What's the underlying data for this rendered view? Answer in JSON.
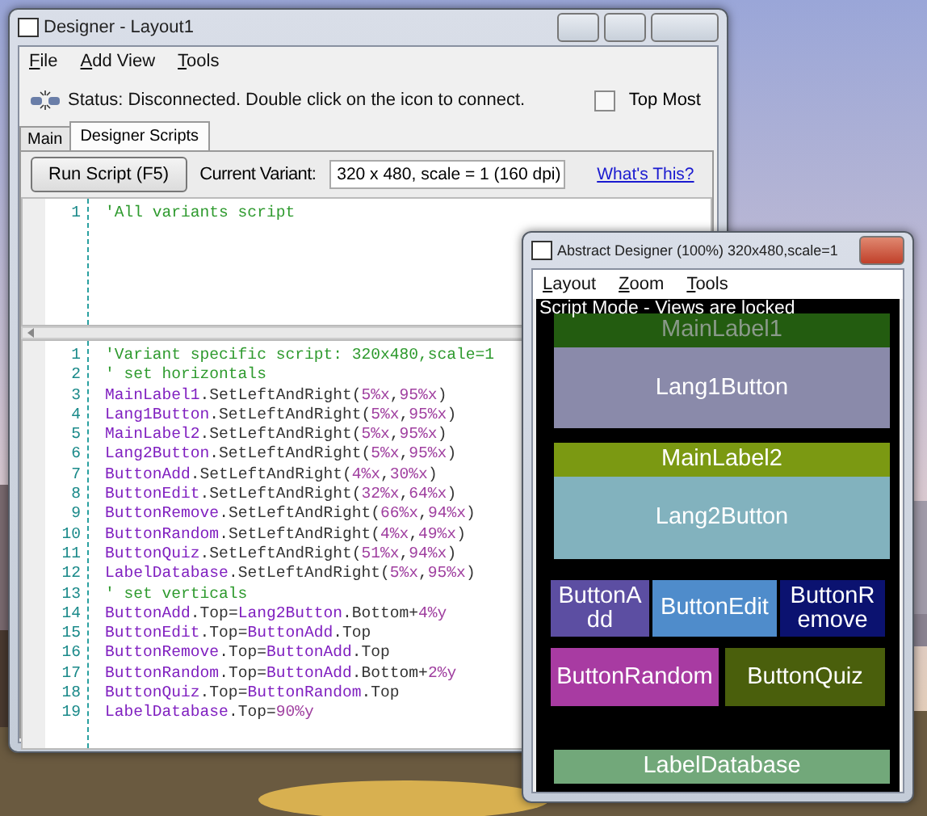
{
  "designer_window": {
    "title": "Designer - Layout1",
    "menu": [
      "File",
      "Add View",
      "Tools"
    ],
    "status": "Status: Disconnected. Double click on the icon to connect.",
    "top_most": {
      "label": "Top Most",
      "checked": false
    },
    "tabs": [
      {
        "label": "Main",
        "selected": false
      },
      {
        "label": "Designer Scripts",
        "selected": true
      }
    ],
    "run_button": "Run Script (F5)",
    "variant_label": "Current Variant:",
    "variant_value": "320 x 480, scale = 1 (160 dpi)",
    "help_link": "What's This?",
    "all_variants_script": [
      {
        "number": "1",
        "tokens": [
          {
            "kind": "comment",
            "text": "'All variants script"
          }
        ]
      }
    ],
    "variant_script": [
      {
        "number": "1",
        "tokens": [
          {
            "kind": "comment",
            "text": "'Variant specific script: 320x480,scale=1"
          }
        ]
      },
      {
        "number": "2",
        "tokens": [
          {
            "kind": "comment",
            "text": "' set horizontals"
          }
        ]
      },
      {
        "number": "3",
        "tokens": [
          {
            "kind": "ident",
            "text": "MainLabel1"
          },
          {
            "kind": "plain",
            "text": ".SetLeftAndRight("
          },
          {
            "kind": "number",
            "text": "5%x"
          },
          {
            "kind": "plain",
            "text": ","
          },
          {
            "kind": "number",
            "text": "95%x"
          },
          {
            "kind": "plain",
            "text": ")"
          }
        ]
      },
      {
        "number": "4",
        "tokens": [
          {
            "kind": "ident",
            "text": "Lang1Button"
          },
          {
            "kind": "plain",
            "text": ".SetLeftAndRight("
          },
          {
            "kind": "number",
            "text": "5%x"
          },
          {
            "kind": "plain",
            "text": ","
          },
          {
            "kind": "number",
            "text": "95%x"
          },
          {
            "kind": "plain",
            "text": ")"
          }
        ]
      },
      {
        "number": "5",
        "tokens": [
          {
            "kind": "ident",
            "text": "MainLabel2"
          },
          {
            "kind": "plain",
            "text": ".SetLeftAndRight("
          },
          {
            "kind": "number",
            "text": "5%x"
          },
          {
            "kind": "plain",
            "text": ","
          },
          {
            "kind": "number",
            "text": "95%x"
          },
          {
            "kind": "plain",
            "text": ")"
          }
        ]
      },
      {
        "number": "6",
        "tokens": [
          {
            "kind": "ident",
            "text": "Lang2Button"
          },
          {
            "kind": "plain",
            "text": ".SetLeftAndRight("
          },
          {
            "kind": "number",
            "text": "5%x"
          },
          {
            "kind": "plain",
            "text": ","
          },
          {
            "kind": "number",
            "text": "95%x"
          },
          {
            "kind": "plain",
            "text": ")"
          }
        ]
      },
      {
        "number": "7",
        "tokens": [
          {
            "kind": "ident",
            "text": "ButtonAdd"
          },
          {
            "kind": "plain",
            "text": ".SetLeftAndRight("
          },
          {
            "kind": "number",
            "text": "4%x"
          },
          {
            "kind": "plain",
            "text": ","
          },
          {
            "kind": "number",
            "text": "30%x"
          },
          {
            "kind": "plain",
            "text": ")"
          }
        ]
      },
      {
        "number": "8",
        "tokens": [
          {
            "kind": "ident",
            "text": "ButtonEdit"
          },
          {
            "kind": "plain",
            "text": ".SetLeftAndRight("
          },
          {
            "kind": "number",
            "text": "32%x"
          },
          {
            "kind": "plain",
            "text": ","
          },
          {
            "kind": "number",
            "text": "64%x"
          },
          {
            "kind": "plain",
            "text": ")"
          }
        ]
      },
      {
        "number": "9",
        "tokens": [
          {
            "kind": "ident",
            "text": "ButtonRemove"
          },
          {
            "kind": "plain",
            "text": ".SetLeftAndRight("
          },
          {
            "kind": "number",
            "text": "66%x"
          },
          {
            "kind": "plain",
            "text": ","
          },
          {
            "kind": "number",
            "text": "94%x"
          },
          {
            "kind": "plain",
            "text": ")"
          }
        ]
      },
      {
        "number": "10",
        "tokens": [
          {
            "kind": "ident",
            "text": "ButtonRandom"
          },
          {
            "kind": "plain",
            "text": ".SetLeftAndRight("
          },
          {
            "kind": "number",
            "text": "4%x"
          },
          {
            "kind": "plain",
            "text": ","
          },
          {
            "kind": "number",
            "text": "49%x"
          },
          {
            "kind": "plain",
            "text": ")"
          }
        ]
      },
      {
        "number": "11",
        "tokens": [
          {
            "kind": "ident",
            "text": "ButtonQuiz"
          },
          {
            "kind": "plain",
            "text": ".SetLeftAndRight("
          },
          {
            "kind": "number",
            "text": "51%x"
          },
          {
            "kind": "plain",
            "text": ","
          },
          {
            "kind": "number",
            "text": "94%x"
          },
          {
            "kind": "plain",
            "text": ")"
          }
        ]
      },
      {
        "number": "12",
        "tokens": [
          {
            "kind": "ident",
            "text": "LabelDatabase"
          },
          {
            "kind": "plain",
            "text": ".SetLeftAndRight("
          },
          {
            "kind": "number",
            "text": "5%x"
          },
          {
            "kind": "plain",
            "text": ","
          },
          {
            "kind": "number",
            "text": "95%x"
          },
          {
            "kind": "plain",
            "text": ")"
          }
        ]
      },
      {
        "number": "13",
        "tokens": [
          {
            "kind": "comment",
            "text": "' set verticals"
          }
        ]
      },
      {
        "number": "14",
        "tokens": [
          {
            "kind": "ident",
            "text": "ButtonAdd"
          },
          {
            "kind": "plain",
            "text": ".Top="
          },
          {
            "kind": "ident",
            "text": "Lang2Button"
          },
          {
            "kind": "plain",
            "text": ".Bottom+"
          },
          {
            "kind": "number",
            "text": "4%y"
          }
        ]
      },
      {
        "number": "15",
        "tokens": [
          {
            "kind": "ident",
            "text": "ButtonEdit"
          },
          {
            "kind": "plain",
            "text": ".Top="
          },
          {
            "kind": "ident",
            "text": "ButtonAdd"
          },
          {
            "kind": "plain",
            "text": ".Top"
          }
        ]
      },
      {
        "number": "16",
        "tokens": [
          {
            "kind": "ident",
            "text": "ButtonRemove"
          },
          {
            "kind": "plain",
            "text": ".Top="
          },
          {
            "kind": "ident",
            "text": "ButtonAdd"
          },
          {
            "kind": "plain",
            "text": ".Top"
          }
        ]
      },
      {
        "number": "17",
        "tokens": [
          {
            "kind": "ident",
            "text": "ButtonRandom"
          },
          {
            "kind": "plain",
            "text": ".Top="
          },
          {
            "kind": "ident",
            "text": "ButtonAdd"
          },
          {
            "kind": "plain",
            "text": ".Bottom+"
          },
          {
            "kind": "number",
            "text": "2%y"
          }
        ]
      },
      {
        "number": "18",
        "tokens": [
          {
            "kind": "ident",
            "text": "ButtonQuiz"
          },
          {
            "kind": "plain",
            "text": ".Top="
          },
          {
            "kind": "ident",
            "text": "ButtonRandom"
          },
          {
            "kind": "plain",
            "text": ".Top"
          }
        ]
      },
      {
        "number": "19",
        "tokens": [
          {
            "kind": "ident",
            "text": "LabelDatabase"
          },
          {
            "kind": "plain",
            "text": ".Top="
          },
          {
            "kind": "number",
            "text": "90%y"
          }
        ]
      }
    ]
  },
  "abstract_designer": {
    "title": "Abstract Designer (100%) 320x480,scale=1",
    "menu": [
      "Layout",
      "Zoom",
      "Tools"
    ],
    "mode_notice": "Script Mode - Views are locked",
    "views": [
      {
        "label": "MainLabel1",
        "color": "#235c10",
        "dimmed": true
      },
      {
        "label": "Lang1Button",
        "color": "#8a8aaa",
        "dimmed": false
      },
      {
        "label": "MainLabel2",
        "color": "#7b9912",
        "dimmed": false
      },
      {
        "label": "Lang2Button",
        "color": "#82b2be",
        "dimmed": false
      },
      {
        "label": "ButtonAdd",
        "color": "#5c4ea2",
        "dimmed": false
      },
      {
        "label": "ButtonEdit",
        "color": "#4f8ccb",
        "dimmed": false
      },
      {
        "label": "ButtonRemove",
        "color": "#0b1270",
        "dimmed": false
      },
      {
        "label": "ButtonRandom",
        "color": "#a83ba2",
        "dimmed": false
      },
      {
        "label": "ButtonQuiz",
        "color": "#4a5f0c",
        "dimmed": false
      },
      {
        "label": "LabelDatabase",
        "color": "#72a87a",
        "dimmed": false
      }
    ]
  }
}
